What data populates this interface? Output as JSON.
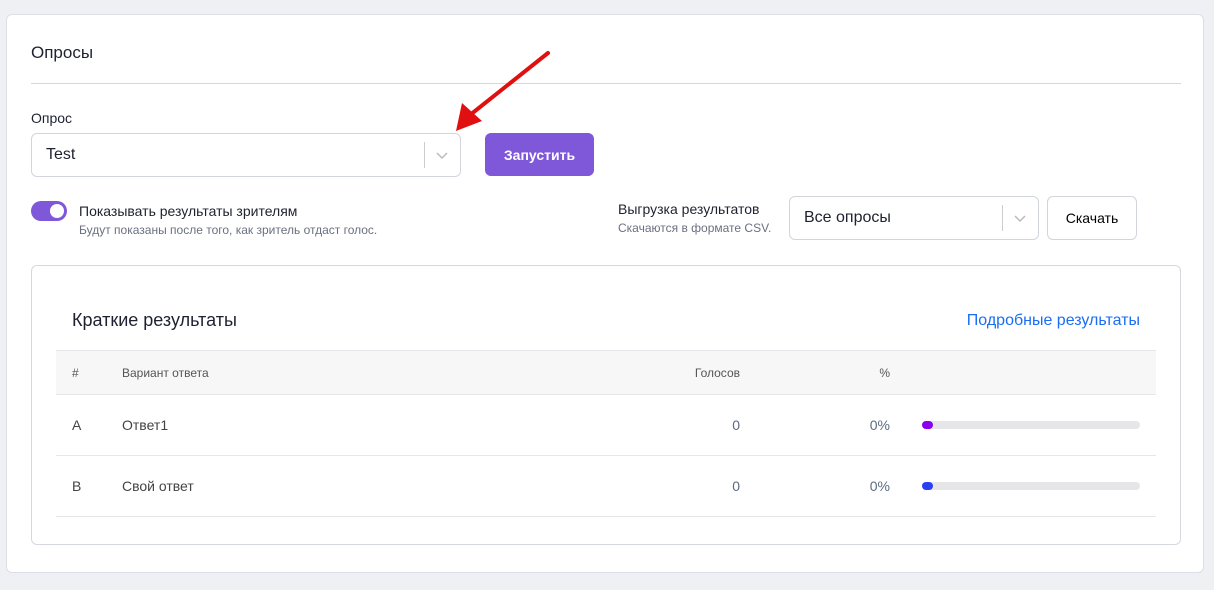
{
  "page": {
    "title": "Опросы"
  },
  "poll": {
    "label": "Опрос",
    "selected": "Test",
    "launch": "Запустить"
  },
  "toggle": {
    "label": "Показывать результаты зрителям",
    "hint": "Будут показаны после того, как зритель отдаст голос.",
    "on": true
  },
  "export": {
    "label": "Выгрузка результатов",
    "hint": "Скачаются в формате CSV.",
    "selected": "Все опросы",
    "download": "Скачать"
  },
  "results": {
    "title": "Краткие результаты",
    "details_link": "Подробные результаты",
    "columns": [
      "#",
      "Вариант ответа",
      "Голосов",
      "%"
    ],
    "rows": [
      {
        "key": "A",
        "answer": "Ответ1",
        "votes": "0",
        "percent": "0%",
        "color": "#8b00f0"
      },
      {
        "key": "B",
        "answer": "Свой ответ",
        "votes": "0",
        "percent": "0%",
        "color": "#2b3ff0"
      }
    ]
  }
}
